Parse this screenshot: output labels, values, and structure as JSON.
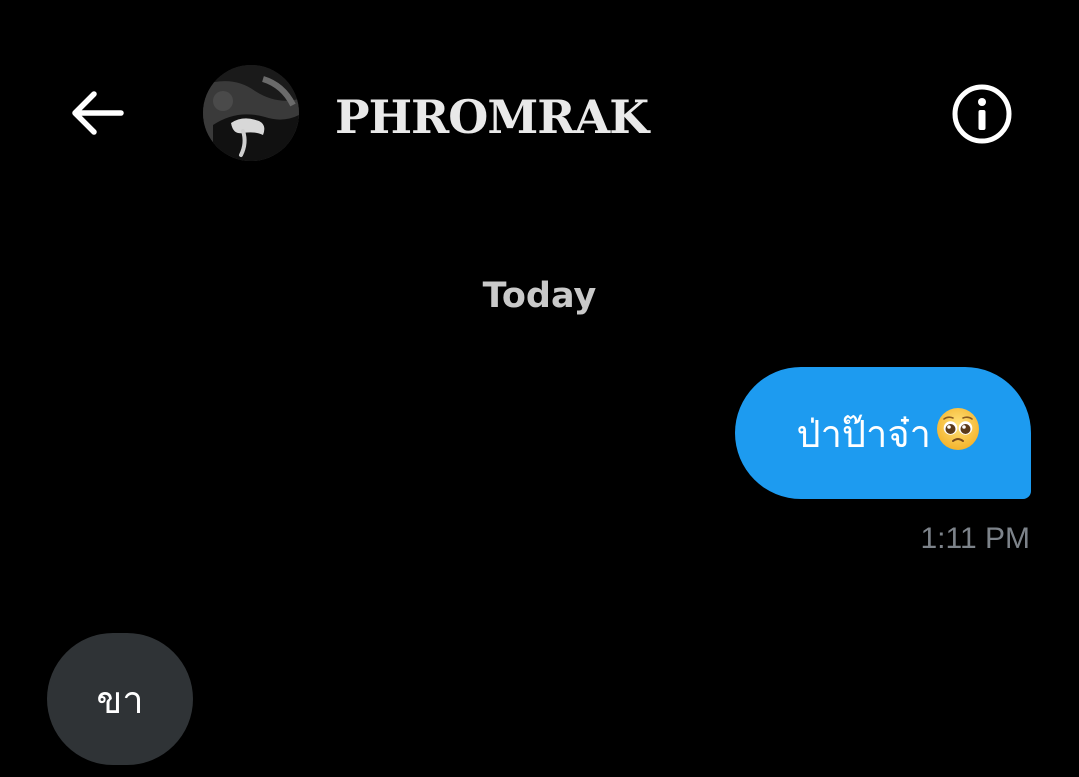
{
  "header": {
    "back_icon": "arrow-left-icon",
    "title": "PHROMRAK",
    "info_icon": "info-circle-icon",
    "avatar": "profile-photo"
  },
  "conversation": {
    "date_separator": "Today",
    "messages": [
      {
        "direction": "outgoing",
        "text": "ป่าป๊าจ๋า",
        "emoji": "pleading-face-emoji",
        "time": "1:11 PM",
        "bubble_color": "#1d9bf0"
      },
      {
        "direction": "incoming",
        "text": "ขา",
        "bubble_color": "#2f3336"
      }
    ]
  },
  "colors": {
    "background": "#000000",
    "accent": "#1d9bf0",
    "muted_text": "#7d838a"
  }
}
